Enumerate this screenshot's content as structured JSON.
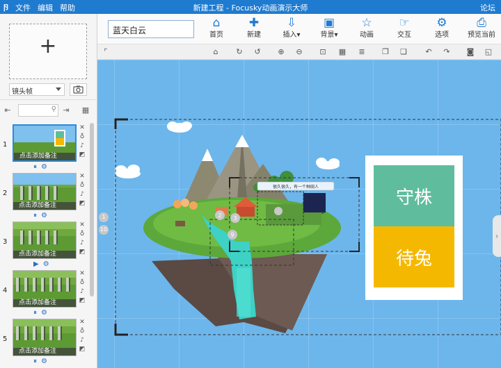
{
  "titlebar": {
    "logo": "卪",
    "menu": [
      "文件",
      "编辑",
      "帮助"
    ],
    "title": "新建工程 - Focusky动画演示大师",
    "right": "论坛"
  },
  "leftpanel": {
    "add_plus": "+",
    "frame_select": "镜头帧",
    "slides": [
      {
        "num": "1",
        "note": "点击添加备注"
      },
      {
        "num": "2",
        "note": "点击添加备注"
      },
      {
        "num": "3",
        "note": "点击添加备注"
      },
      {
        "num": "4",
        "note": "点击添加备注"
      },
      {
        "num": "5",
        "note": "点击添加备注"
      }
    ]
  },
  "topbar": {
    "project_name": "蓝天白云",
    "buttons": [
      {
        "label": "首页",
        "icon": "home-icon"
      },
      {
        "label": "新建",
        "icon": "new-icon"
      },
      {
        "label": "插入▾",
        "icon": "insert-icon"
      },
      {
        "label": "背景▾",
        "icon": "background-icon"
      },
      {
        "label": "动画",
        "icon": "animation-icon"
      },
      {
        "label": "交互",
        "icon": "interaction-icon"
      },
      {
        "label": "选项",
        "icon": "settings-icon"
      },
      {
        "label": "预览当前",
        "icon": "preview-icon"
      }
    ]
  },
  "canvas": {
    "card_top_text": "守株",
    "card_bottom_text": "待兔",
    "banner_text": "很久很久，有一个种田人",
    "markers": [
      "1",
      "10",
      "2",
      "3",
      "9"
    ],
    "colors": {
      "sky": "#6cb6ec",
      "card_top": "#5fbd9e",
      "card_bottom": "#f5b800"
    }
  }
}
